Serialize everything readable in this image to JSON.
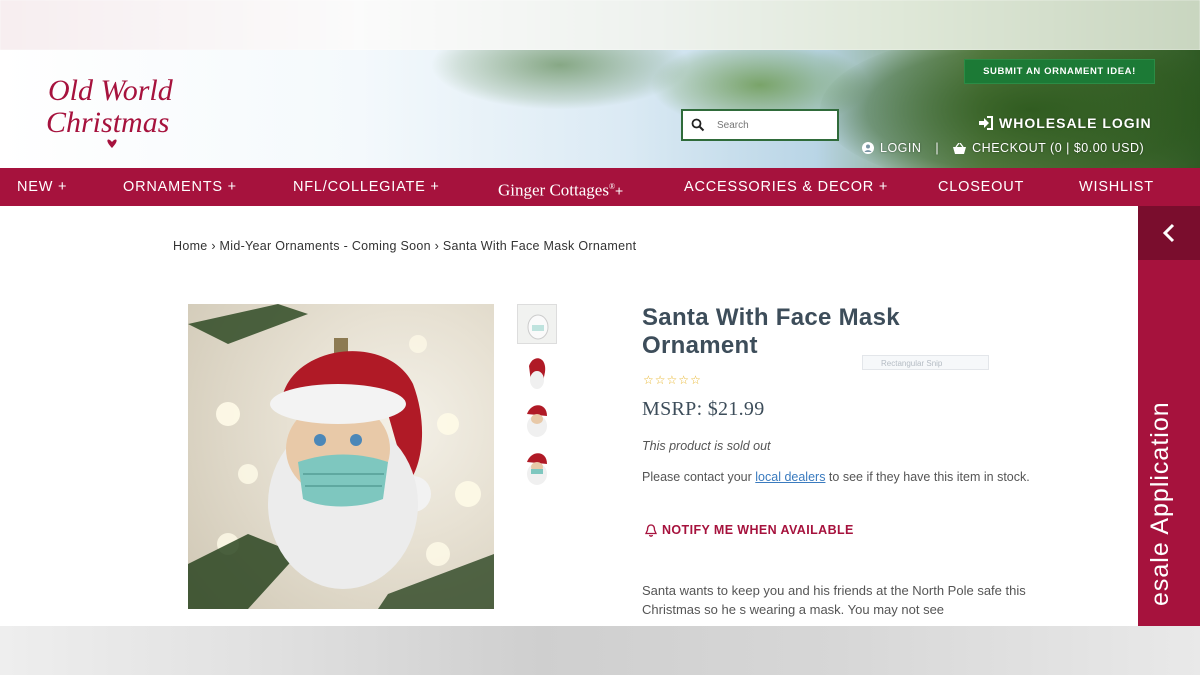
{
  "header": {
    "logo_line1": "Old World",
    "logo_line2": "Christmas",
    "submit_label": "SUBMIT AN ORNAMENT IDEA!",
    "search_placeholder": "Search",
    "wholesale_label": "WHOLESALE LOGIN",
    "login_label": "LOGIN",
    "separator": "|",
    "checkout_label": "CHECKOUT (0 | $0.00 USD)"
  },
  "nav": {
    "items": [
      "NEW +",
      "ORNAMENTS +",
      "NFL/COLLEGIATE +",
      "Ginger Cottages",
      "ACCESSORIES & DECOR +",
      "CLOSEOUT",
      "WISHLIST"
    ],
    "ginger_plus": "+",
    "ginger_reg": "®"
  },
  "side_panel": {
    "text": "esale Application"
  },
  "breadcrumb": "Home › Mid-Year Ornaments - Coming Soon › Santa With Face Mask Ornament",
  "product": {
    "title": "Santa With Face Mask Ornament",
    "rating_stars": 0,
    "price": "MSRP: $21.99",
    "status": "This product is sold out",
    "contact_before": "Please contact your ",
    "contact_link": "local dealers",
    "contact_after": " to see if they have this item in stock.",
    "notify_label": "NOTIFY ME WHEN AVAILABLE",
    "description": "Santa wants to keep you and his friends at the North Pole safe this Christmas so he s wearing a mask. You may not see"
  },
  "overlay": {
    "snip_label": "Rectangular Snip"
  },
  "colors": {
    "brand": "#a6123d",
    "submit_green": "#1c7a36",
    "title": "#3d4d5a"
  }
}
